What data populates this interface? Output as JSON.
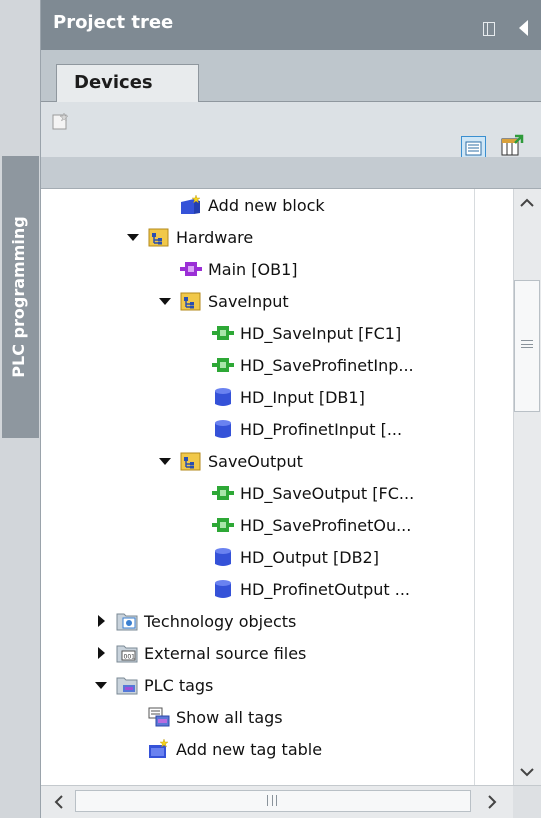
{
  "header": {
    "title": "Project tree"
  },
  "side_tab": {
    "label": "PLC programming"
  },
  "tabs": [
    {
      "label": "Devices"
    }
  ],
  "tree": {
    "items": [
      {
        "label": "Add new block",
        "icon": "add-new-block-icon",
        "indent": 4,
        "expander": "none"
      },
      {
        "label": "Hardware",
        "icon": "folder-group-icon",
        "indent": 3,
        "expander": "expanded"
      },
      {
        "label": "Main [OB1]",
        "icon": "ob-block-icon",
        "indent": 4,
        "expander": "none"
      },
      {
        "label": "SaveInput",
        "icon": "folder-group-icon",
        "indent": 4,
        "expander": "expanded"
      },
      {
        "label": "HD_SaveInput [FC1]",
        "icon": "fc-block-icon",
        "indent": 5,
        "expander": "none"
      },
      {
        "label": "HD_SaveProfinetInp...",
        "icon": "fc-block-icon",
        "indent": 5,
        "expander": "none"
      },
      {
        "label": "HD_Input [DB1]",
        "icon": "db-block-icon",
        "indent": 5,
        "expander": "none"
      },
      {
        "label": "HD_ProfinetInput [...",
        "icon": "db-block-icon",
        "indent": 5,
        "expander": "none"
      },
      {
        "label": "SaveOutput",
        "icon": "folder-group-icon",
        "indent": 4,
        "expander": "expanded"
      },
      {
        "label": "HD_SaveOutput [FC...",
        "icon": "fc-block-icon",
        "indent": 5,
        "expander": "none"
      },
      {
        "label": "HD_SaveProfinetOu...",
        "icon": "fc-block-icon",
        "indent": 5,
        "expander": "none"
      },
      {
        "label": "HD_Output [DB2]",
        "icon": "db-block-icon",
        "indent": 5,
        "expander": "none"
      },
      {
        "label": "HD_ProfinetOutput ...",
        "icon": "db-block-icon",
        "indent": 5,
        "expander": "none"
      },
      {
        "label": "Technology objects",
        "icon": "technology-objects-icon",
        "indent": 2,
        "expander": "collapsed"
      },
      {
        "label": "External source files",
        "icon": "external-source-icon",
        "indent": 2,
        "expander": "collapsed"
      },
      {
        "label": "PLC tags",
        "icon": "plc-tags-folder-icon",
        "indent": 2,
        "expander": "expanded"
      },
      {
        "label": "Show all tags",
        "icon": "show-all-tags-icon",
        "indent": 3,
        "expander": "none"
      },
      {
        "label": "Add new tag table",
        "icon": "add-tag-table-icon",
        "indent": 3,
        "expander": "none"
      }
    ]
  },
  "colors": {
    "header_bg": "#7f8a93",
    "side_tab_bg": "#8e979f",
    "fc_green": "#2ea836",
    "ob_purple": "#9b2fd6",
    "db_blue": "#3552d8",
    "folder_yellow": "#f1c84a"
  }
}
